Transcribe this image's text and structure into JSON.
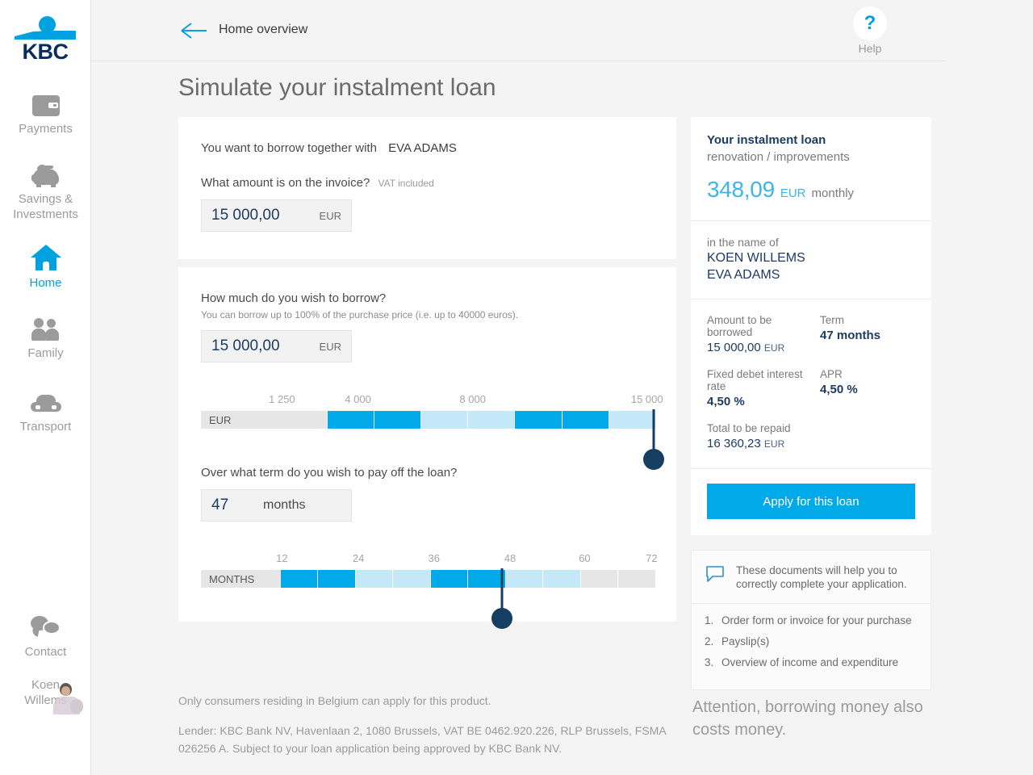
{
  "sidebar": {
    "logo_text": "KBC",
    "items": [
      {
        "label": "Payments",
        "icon": "wallet-icon",
        "active": false
      },
      {
        "label": "Savings & Investments",
        "icon": "piggy-bank-icon",
        "active": false
      },
      {
        "label": "Home",
        "icon": "house-icon",
        "active": true
      },
      {
        "label": "Family",
        "icon": "family-icon",
        "active": false
      },
      {
        "label": "Transport",
        "icon": "car-icon",
        "active": false
      },
      {
        "label": "Contact",
        "icon": "chat-bubbles-icon",
        "active": false
      }
    ],
    "user": {
      "first_name": "Koen",
      "last_name": "Willems",
      "avatar": "user-photo"
    }
  },
  "header": {
    "back_icon": "back-arrow-icon",
    "breadcrumb": "Home overview",
    "help_icon": "question-mark-icon",
    "help_label": "Help"
  },
  "page": {
    "title": "Simulate your instalment loan"
  },
  "invoice_card": {
    "borrow_with_label": "You want to borrow together with",
    "co_borrower": "EVA ADAMS",
    "amount_question": "What amount is on the invoice?",
    "amount_note": "VAT included",
    "amount_value": "15 000,00",
    "amount_currency": "EUR"
  },
  "borrow_card": {
    "question": "How much do you wish to borrow?",
    "note": "You can borrow up to 100% of the purchase price (i.e. up to 40000 euros).",
    "value": "15 000,00",
    "currency": "EUR",
    "slider": {
      "unit_label": "EUR",
      "ticks": [
        {
          "label": "1 250",
          "pos": 17.8
        },
        {
          "label": "4 000",
          "pos": 34.5
        },
        {
          "label": "8 000",
          "pos": 59.7
        },
        {
          "label": "15 000",
          "pos": 98.0
        }
      ],
      "segments": [
        "dis",
        "on",
        "on",
        "off",
        "off",
        "on",
        "on",
        "off"
      ],
      "label_width_pct": 17.5,
      "handle_pos": 99.5
    }
  },
  "term_card": {
    "question": "Over what term do you wish to pay off the loan?",
    "value": "47",
    "unit": "months",
    "slider": {
      "unit_label": "MONTHS",
      "ticks": [
        {
          "label": "12",
          "pos": 17.8
        },
        {
          "label": "24",
          "pos": 34.6
        },
        {
          "label": "36",
          "pos": 51.2
        },
        {
          "label": "48",
          "pos": 67.9
        },
        {
          "label": "60",
          "pos": 84.3
        },
        {
          "label": "72",
          "pos": 99.0
        }
      ],
      "segments": [
        "on",
        "on",
        "off",
        "off",
        "on",
        "on",
        "off",
        "off",
        "dis",
        "dis"
      ],
      "label_width_pct": 17.5,
      "handle_pos": 66.2
    }
  },
  "summary": {
    "title": "Your instalment loan",
    "purpose": "renovation / improvements",
    "monthly_amount": "348,09",
    "monthly_currency": "EUR",
    "monthly_suffix": "monthly",
    "in_name_of_label": "in the name of",
    "names": [
      "KOEN WILLEMS",
      "EVA ADAMS"
    ],
    "details": {
      "amount_label": "Amount to be borrowed",
      "amount_value": "15 000,00",
      "amount_currency": "EUR",
      "term_label": "Term",
      "term_value": "47 months",
      "rate_label": "Fixed debet interest rate",
      "rate_value": "4,50 %",
      "apr_label": "APR",
      "apr_value": "4,50 %",
      "total_label": "Total to be repaid",
      "total_value": "16 360,23",
      "total_currency": "EUR"
    },
    "apply_button": "Apply for this loan"
  },
  "documents": {
    "icon": "speech-bubble-icon",
    "intro": "These documents will help you to correctly complete your application.",
    "items": [
      "Order form or invoice for your purchase",
      "Payslip(s)",
      "Overview of income and expenditure"
    ]
  },
  "footer": {
    "residency": "Only consumers residing in Belgium can apply for this product.",
    "lender": "Lender: KBC Bank NV, Havenlaan 2, 1080 Brussels, VAT BE 0462.920.226, RLP Brussels, FSMA 026256 A. Subject to your loan application being approved by KBC Bank NV.",
    "attention": "Attention, borrowing money also costs money."
  },
  "colors": {
    "brand_blue": "#00a1e0",
    "slider_on": "#00a9e8",
    "slider_off": "#c3e8f8",
    "slider_disabled": "#e6e6e6",
    "navy": "#163e63",
    "text_dark": "#1d3b63",
    "muted": "#9b9b9b"
  }
}
